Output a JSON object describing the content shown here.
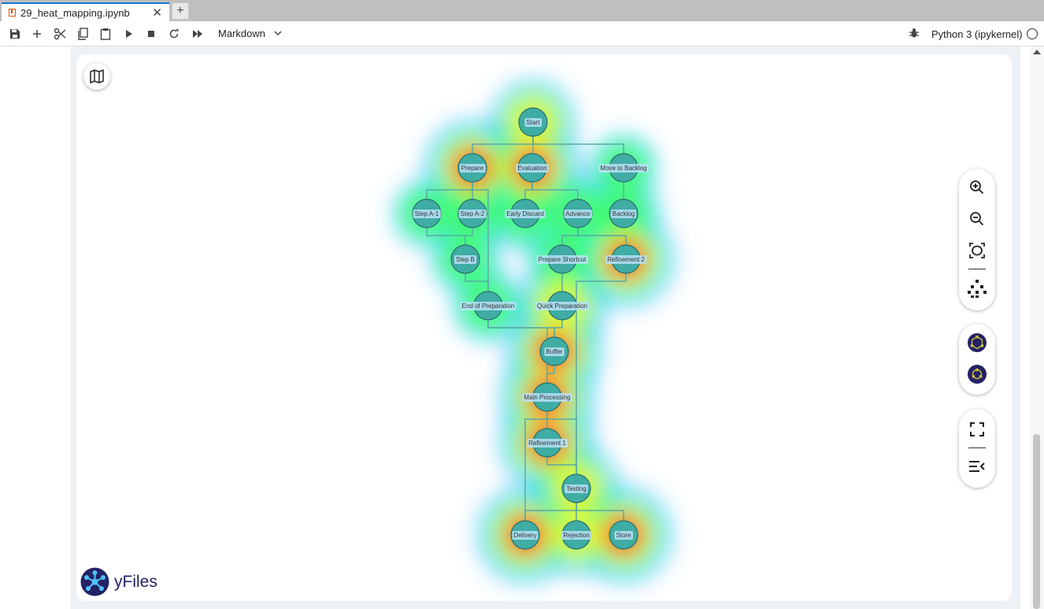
{
  "tab": {
    "title": "29_heat_mapping.ipynb",
    "new_tab": "+",
    "close": "✕"
  },
  "toolbar": {
    "cell_type": "Markdown",
    "kernel": "Python 3 (ipykernel)"
  },
  "widget": {
    "brand": "yFiles"
  },
  "colors": {
    "node_fill": "#3fada4",
    "node_stroke": "#2a6f6a",
    "edge": "#5aaaa4",
    "brand": "#242265",
    "tab_accent": "#1976d2"
  },
  "graph": {
    "nodes": [
      {
        "id": "start",
        "label": "Start",
        "heat": 0.7
      },
      {
        "id": "prepare",
        "label": "Prepare",
        "heat": 1.0
      },
      {
        "id": "evaluation",
        "label": "Evaluation",
        "heat": 1.0
      },
      {
        "id": "move_to_backlog",
        "label": "Move to Backlog",
        "heat": 0.3
      },
      {
        "id": "step_a1",
        "label": "Step A-1",
        "heat": 0.3
      },
      {
        "id": "step_a2",
        "label": "Step A-2",
        "heat": 0.45
      },
      {
        "id": "early_discard",
        "label": "Early Discard",
        "heat": 0.45
      },
      {
        "id": "advance",
        "label": "Advance",
        "heat": 0.55
      },
      {
        "id": "backlog",
        "label": "Backlog",
        "heat": 0.45
      },
      {
        "id": "step_b",
        "label": "Step B",
        "heat": 0.35
      },
      {
        "id": "prepare_shortcut",
        "label": "Prepare Shortcut",
        "heat": 0.35
      },
      {
        "id": "refinement_2",
        "label": "Refinement 2",
        "heat": 1.0
      },
      {
        "id": "end_of_preparation",
        "label": "End of Preparation",
        "heat": 0.4
      },
      {
        "id": "quick_preparation",
        "label": "Quick Preparation",
        "heat": 0.8
      },
      {
        "id": "buffer",
        "label": "Buffer",
        "heat": 1.0
      },
      {
        "id": "main_processing",
        "label": "Main Processing",
        "heat": 0.95
      },
      {
        "id": "refinement_1",
        "label": "Refinement 1",
        "heat": 1.0
      },
      {
        "id": "testing",
        "label": "Testing",
        "heat": 0.75
      },
      {
        "id": "delivery",
        "label": "Delivery",
        "heat": 1.0
      },
      {
        "id": "rejection",
        "label": "Rejection",
        "heat": 0.6
      },
      {
        "id": "store",
        "label": "Store",
        "heat": 1.0
      }
    ],
    "edges": [
      [
        "start",
        "prepare"
      ],
      [
        "start",
        "evaluation"
      ],
      [
        "start",
        "move_to_backlog"
      ],
      [
        "prepare",
        "step_a1"
      ],
      [
        "prepare",
        "step_a2"
      ],
      [
        "prepare",
        "end_of_preparation"
      ],
      [
        "evaluation",
        "early_discard"
      ],
      [
        "evaluation",
        "advance"
      ],
      [
        "move_to_backlog",
        "backlog"
      ],
      [
        "step_a1",
        "step_b"
      ],
      [
        "step_a2",
        "step_b"
      ],
      [
        "advance",
        "prepare_shortcut"
      ],
      [
        "advance",
        "refinement_2"
      ],
      [
        "step_b",
        "end_of_preparation"
      ],
      [
        "prepare_shortcut",
        "quick_preparation"
      ],
      [
        "end_of_preparation",
        "buffer"
      ],
      [
        "end_of_preparation",
        "main_processing"
      ],
      [
        "quick_preparation",
        "buffer"
      ],
      [
        "buffer",
        "main_processing"
      ],
      [
        "main_processing",
        "refinement_1"
      ],
      [
        "main_processing",
        "delivery"
      ],
      [
        "main_processing",
        "testing"
      ],
      [
        "refinement_1",
        "testing"
      ],
      [
        "refinement_2",
        "testing"
      ],
      [
        "testing",
        "delivery"
      ],
      [
        "testing",
        "rejection"
      ],
      [
        "testing",
        "store"
      ]
    ]
  }
}
